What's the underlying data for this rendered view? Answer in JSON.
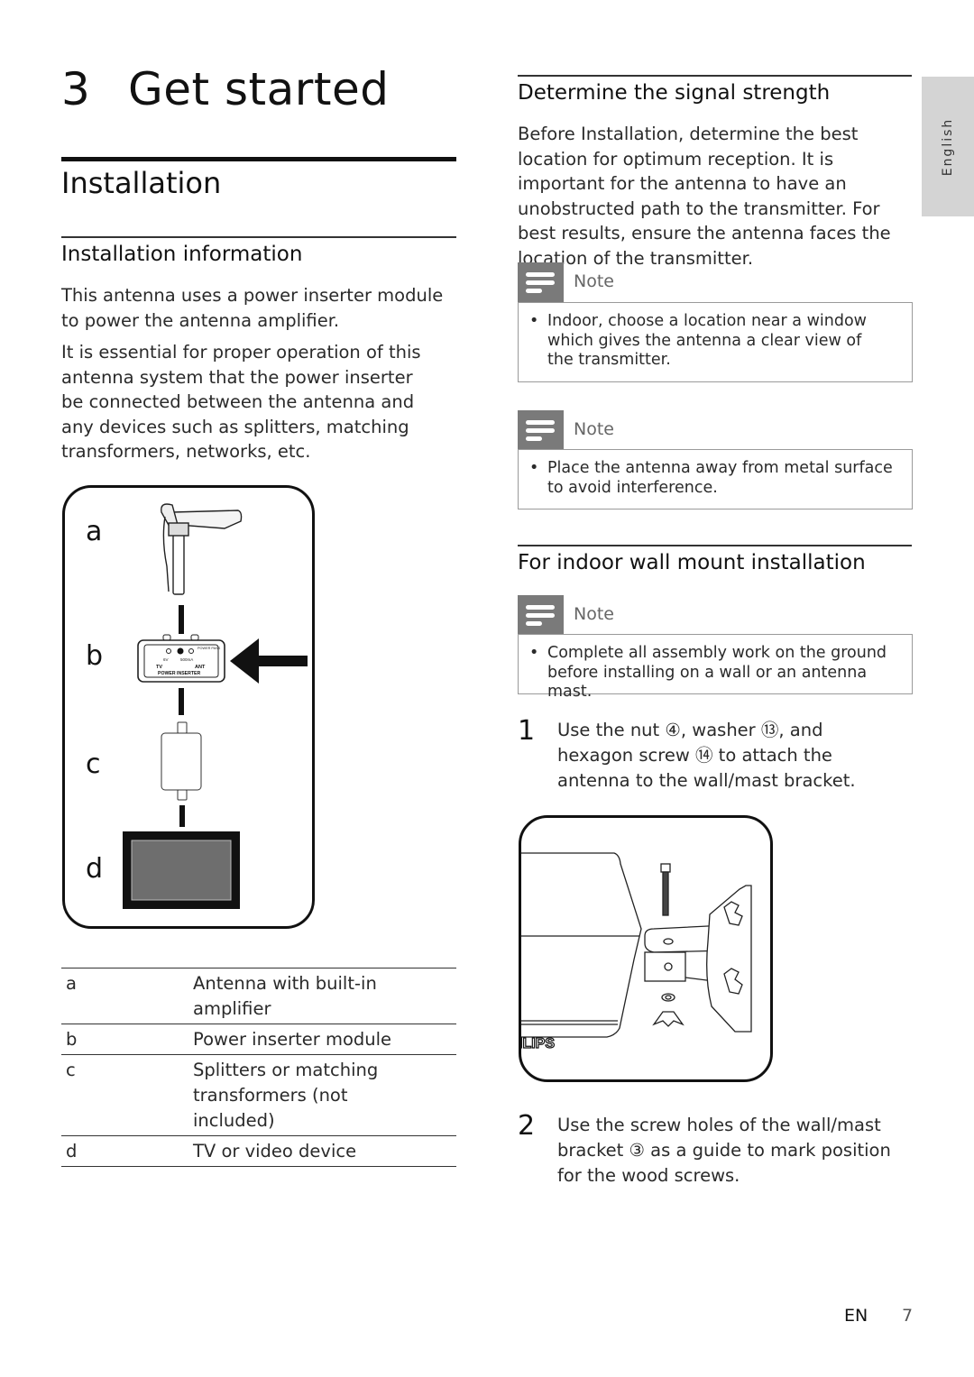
{
  "chapter": {
    "number": "3",
    "title": "Get started"
  },
  "section": {
    "title": "Installation"
  },
  "installation_info": {
    "heading": "Installation information",
    "paragraphs": [
      "This antenna uses a power inserter module to power the antenna amplifier.",
      "It is essential for proper operation of this antenna system that the power inserter be connected between the antenna and any devices such as splitters, matching transformers, networks, etc."
    ]
  },
  "diagram": {
    "labels": [
      "a",
      "b",
      "c",
      "d"
    ],
    "inserter_text": {
      "title": "POWER INSERTER",
      "left": "TV",
      "right": "ANT",
      "power": "POWER PASS",
      "voltage": "6V",
      "current": "500mA"
    }
  },
  "legend": [
    {
      "key": "a",
      "value": "Antenna with built-in amplifier"
    },
    {
      "key": "b",
      "value": "Power inserter module"
    },
    {
      "key": "c",
      "value": "Splitters or matching transformers (not included)"
    },
    {
      "key": "d",
      "value": "TV or video device"
    }
  ],
  "signal": {
    "heading": "Determine the signal strength",
    "paragraph": "Before Installation, determine the best location for optimum reception. It is important for the antenna to have an unobstructed path to the transmitter. For best results, ensure the antenna faces the location of the transmitter."
  },
  "notes": [
    {
      "label": "Note",
      "icon": "note-icon",
      "text": "Indoor, choose a location near a window which gives the antenna a clear view of the transmitter."
    },
    {
      "label": "Note",
      "icon": "note-icon",
      "text": "Place the antenna away from metal surface to avoid interference."
    },
    {
      "label": "Note",
      "icon": "note-icon",
      "text": "Complete all assembly work on the ground before installing on a wall or an antenna mast."
    }
  ],
  "wall_mount": {
    "heading": "For indoor wall mount installation",
    "steps": [
      {
        "number": "1",
        "text": "Use the nut ④, washer ⑬, and hexagon screw ⑭ to attach the antenna to the wall/mast bracket."
      },
      {
        "number": "2",
        "text": "Use the screw holes of the wall/mast bracket ③ as a guide to mark position for the wood screws."
      }
    ],
    "illustration_brand": "ILIPS"
  },
  "language_tab": "English",
  "footer": {
    "lang": "EN",
    "page": "7"
  },
  "colors": {
    "note_icon_bg": "#7a7a7a",
    "lang_tab_bg": "#d4d4d4",
    "tv_screen": "#6e6e6e"
  }
}
